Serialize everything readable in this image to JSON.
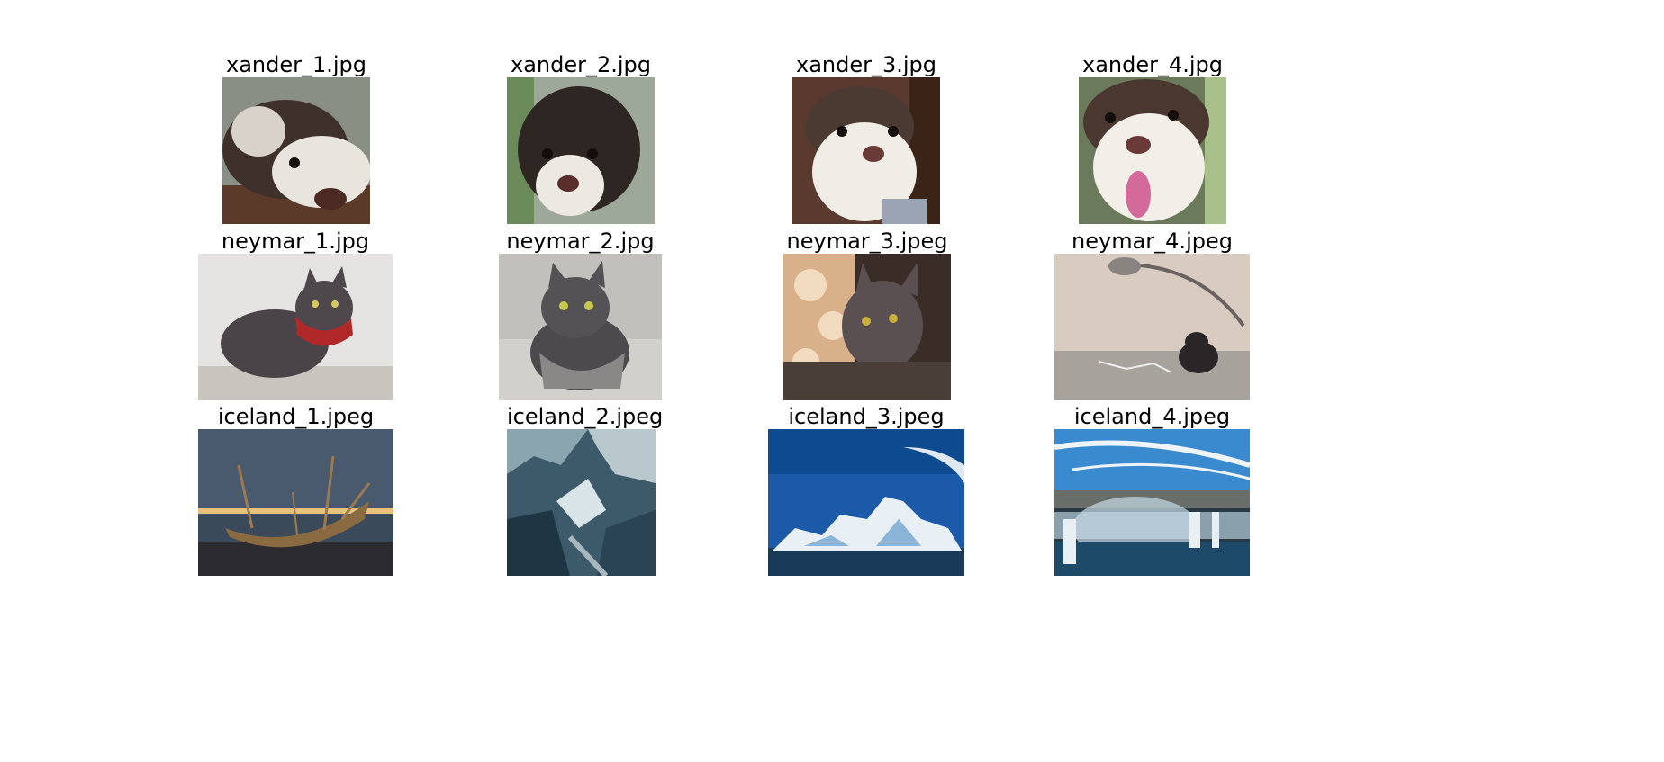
{
  "figure": {
    "rows": [
      {
        "group": "xander",
        "images": [
          {
            "title": "xander_1.jpg",
            "subject": "brown-and-white dog lying with head resting"
          },
          {
            "title": "xander_2.jpg",
            "subject": "brown-and-white dog close-up face"
          },
          {
            "title": "xander_3.jpg",
            "subject": "brown-and-white dog face close-up indoors"
          },
          {
            "title": "xander_4.jpg",
            "subject": "brown-and-white dog with tongue out"
          }
        ]
      },
      {
        "group": "neymar",
        "images": [
          {
            "title": "neymar_1.jpg",
            "subject": "grey cat wearing red plaid bandana"
          },
          {
            "title": "neymar_2.jpg",
            "subject": "grey cat wearing grey vest on sofa"
          },
          {
            "title": "neymar_3.jpeg",
            "subject": "grey cat near decorative screen"
          },
          {
            "title": "neymar_4.jpeg",
            "subject": "grey cat on sofa under arc lamp"
          }
        ]
      },
      {
        "group": "iceland",
        "images": [
          {
            "title": "iceland_1.jpeg",
            "subject": "Viking ship sculpture at dusk by water"
          },
          {
            "title": "iceland_2.jpeg",
            "subject": "blue ice cave interior"
          },
          {
            "title": "iceland_3.jpeg",
            "subject": "icebergs on blue water under blue sky"
          },
          {
            "title": "iceland_4.jpeg",
            "subject": "waterfall canyon with mist and blue sky"
          }
        ]
      }
    ]
  }
}
